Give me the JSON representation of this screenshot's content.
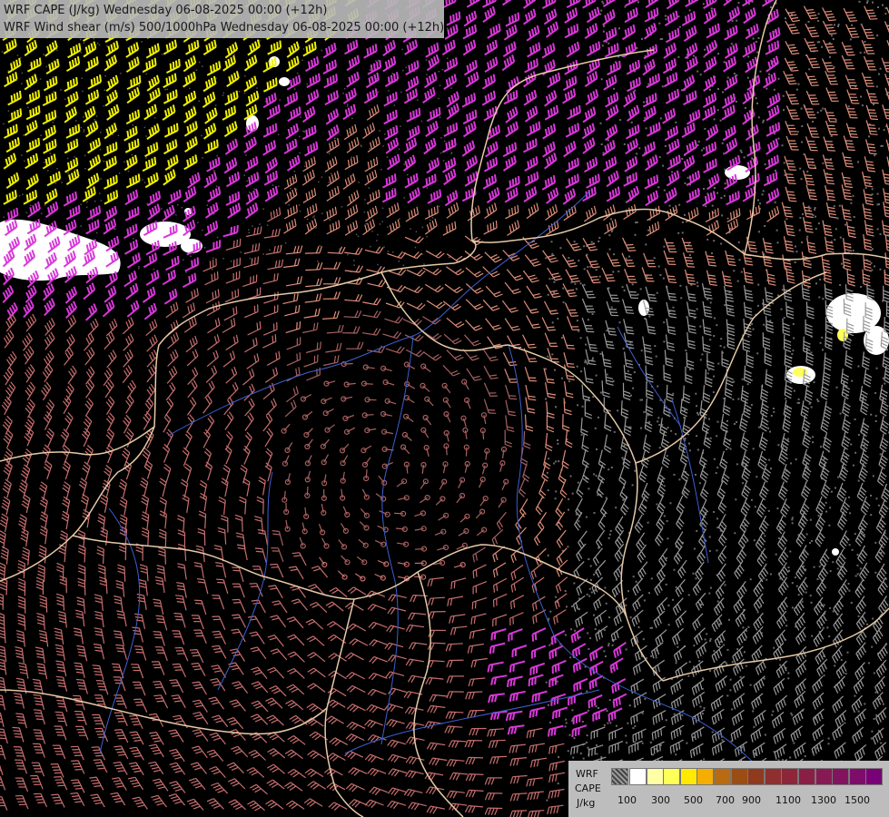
{
  "title": {
    "line1": "WRF CAPE (J/kg) Wednesday 06-08-2025 00:00 (+12h)",
    "line2": "WRF Wind shear (m/s) 500/1000hPa Wednesday 06-08-2025 00:00 (+12h)"
  },
  "legend": {
    "model": "WRF",
    "field": "CAPE",
    "unit": "J/kg",
    "ticks": [
      "100",
      "300",
      "500",
      "700",
      "900",
      "1100",
      "1300",
      "1500"
    ],
    "colors": [
      "#ffffff",
      "#ffffa6",
      "#ffff5a",
      "#ffea00",
      "#f5ad00",
      "#b96b12",
      "#9b4d14",
      "#8f3a1d",
      "#8f2f2f",
      "#8d2638",
      "#8a1f45",
      "#871a55",
      "#84135f",
      "#7f0c6b",
      "#7a0078"
    ]
  },
  "layers": {
    "barb_colors": [
      "#a86060",
      "#c86e6e",
      "#e08e7a",
      "#d838d8",
      "#f0f000",
      "#9a9a9a"
    ],
    "border_color": "#e6c9a6",
    "river_color": "#3c5fd0",
    "terrain_color": "#6a6a6a"
  }
}
